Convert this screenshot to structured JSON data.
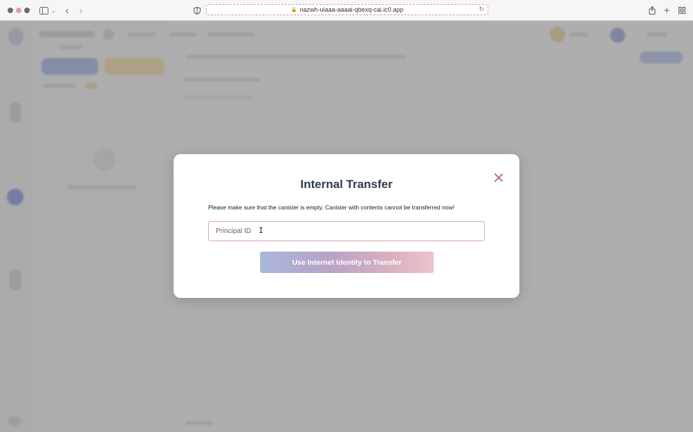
{
  "browser": {
    "url": "nazwh-uiaaa-aaaai-qbexq-cai.ic0.app",
    "icons": {
      "sidebar_toggle": "sidebar-icon",
      "chevron": "chevron-down-icon",
      "back": "chevron-left-icon",
      "forward": "chevron-right-icon",
      "privacy": "shield-icon",
      "lock": "lock-icon",
      "translate": "translate-icon",
      "reload": "reload-icon",
      "share": "share-icon",
      "new_tab": "plus-icon",
      "tab_overview": "grid-icon"
    }
  },
  "modal": {
    "title": "Internal Transfer",
    "message": "Please make sure that the canister is empty. Canister with contents cannot be transferred now!",
    "principal_placeholder": "Principal ID",
    "principal_value": "",
    "submit_label": "Use Internet Identity to Transfer",
    "close_icon": "close-icon"
  },
  "colors": {
    "title": "#2e3a4e",
    "accent_pink": "#c06a7c",
    "button_gradient_start": "#a9b8dc",
    "button_gradient_end": "#ebc4c9"
  }
}
